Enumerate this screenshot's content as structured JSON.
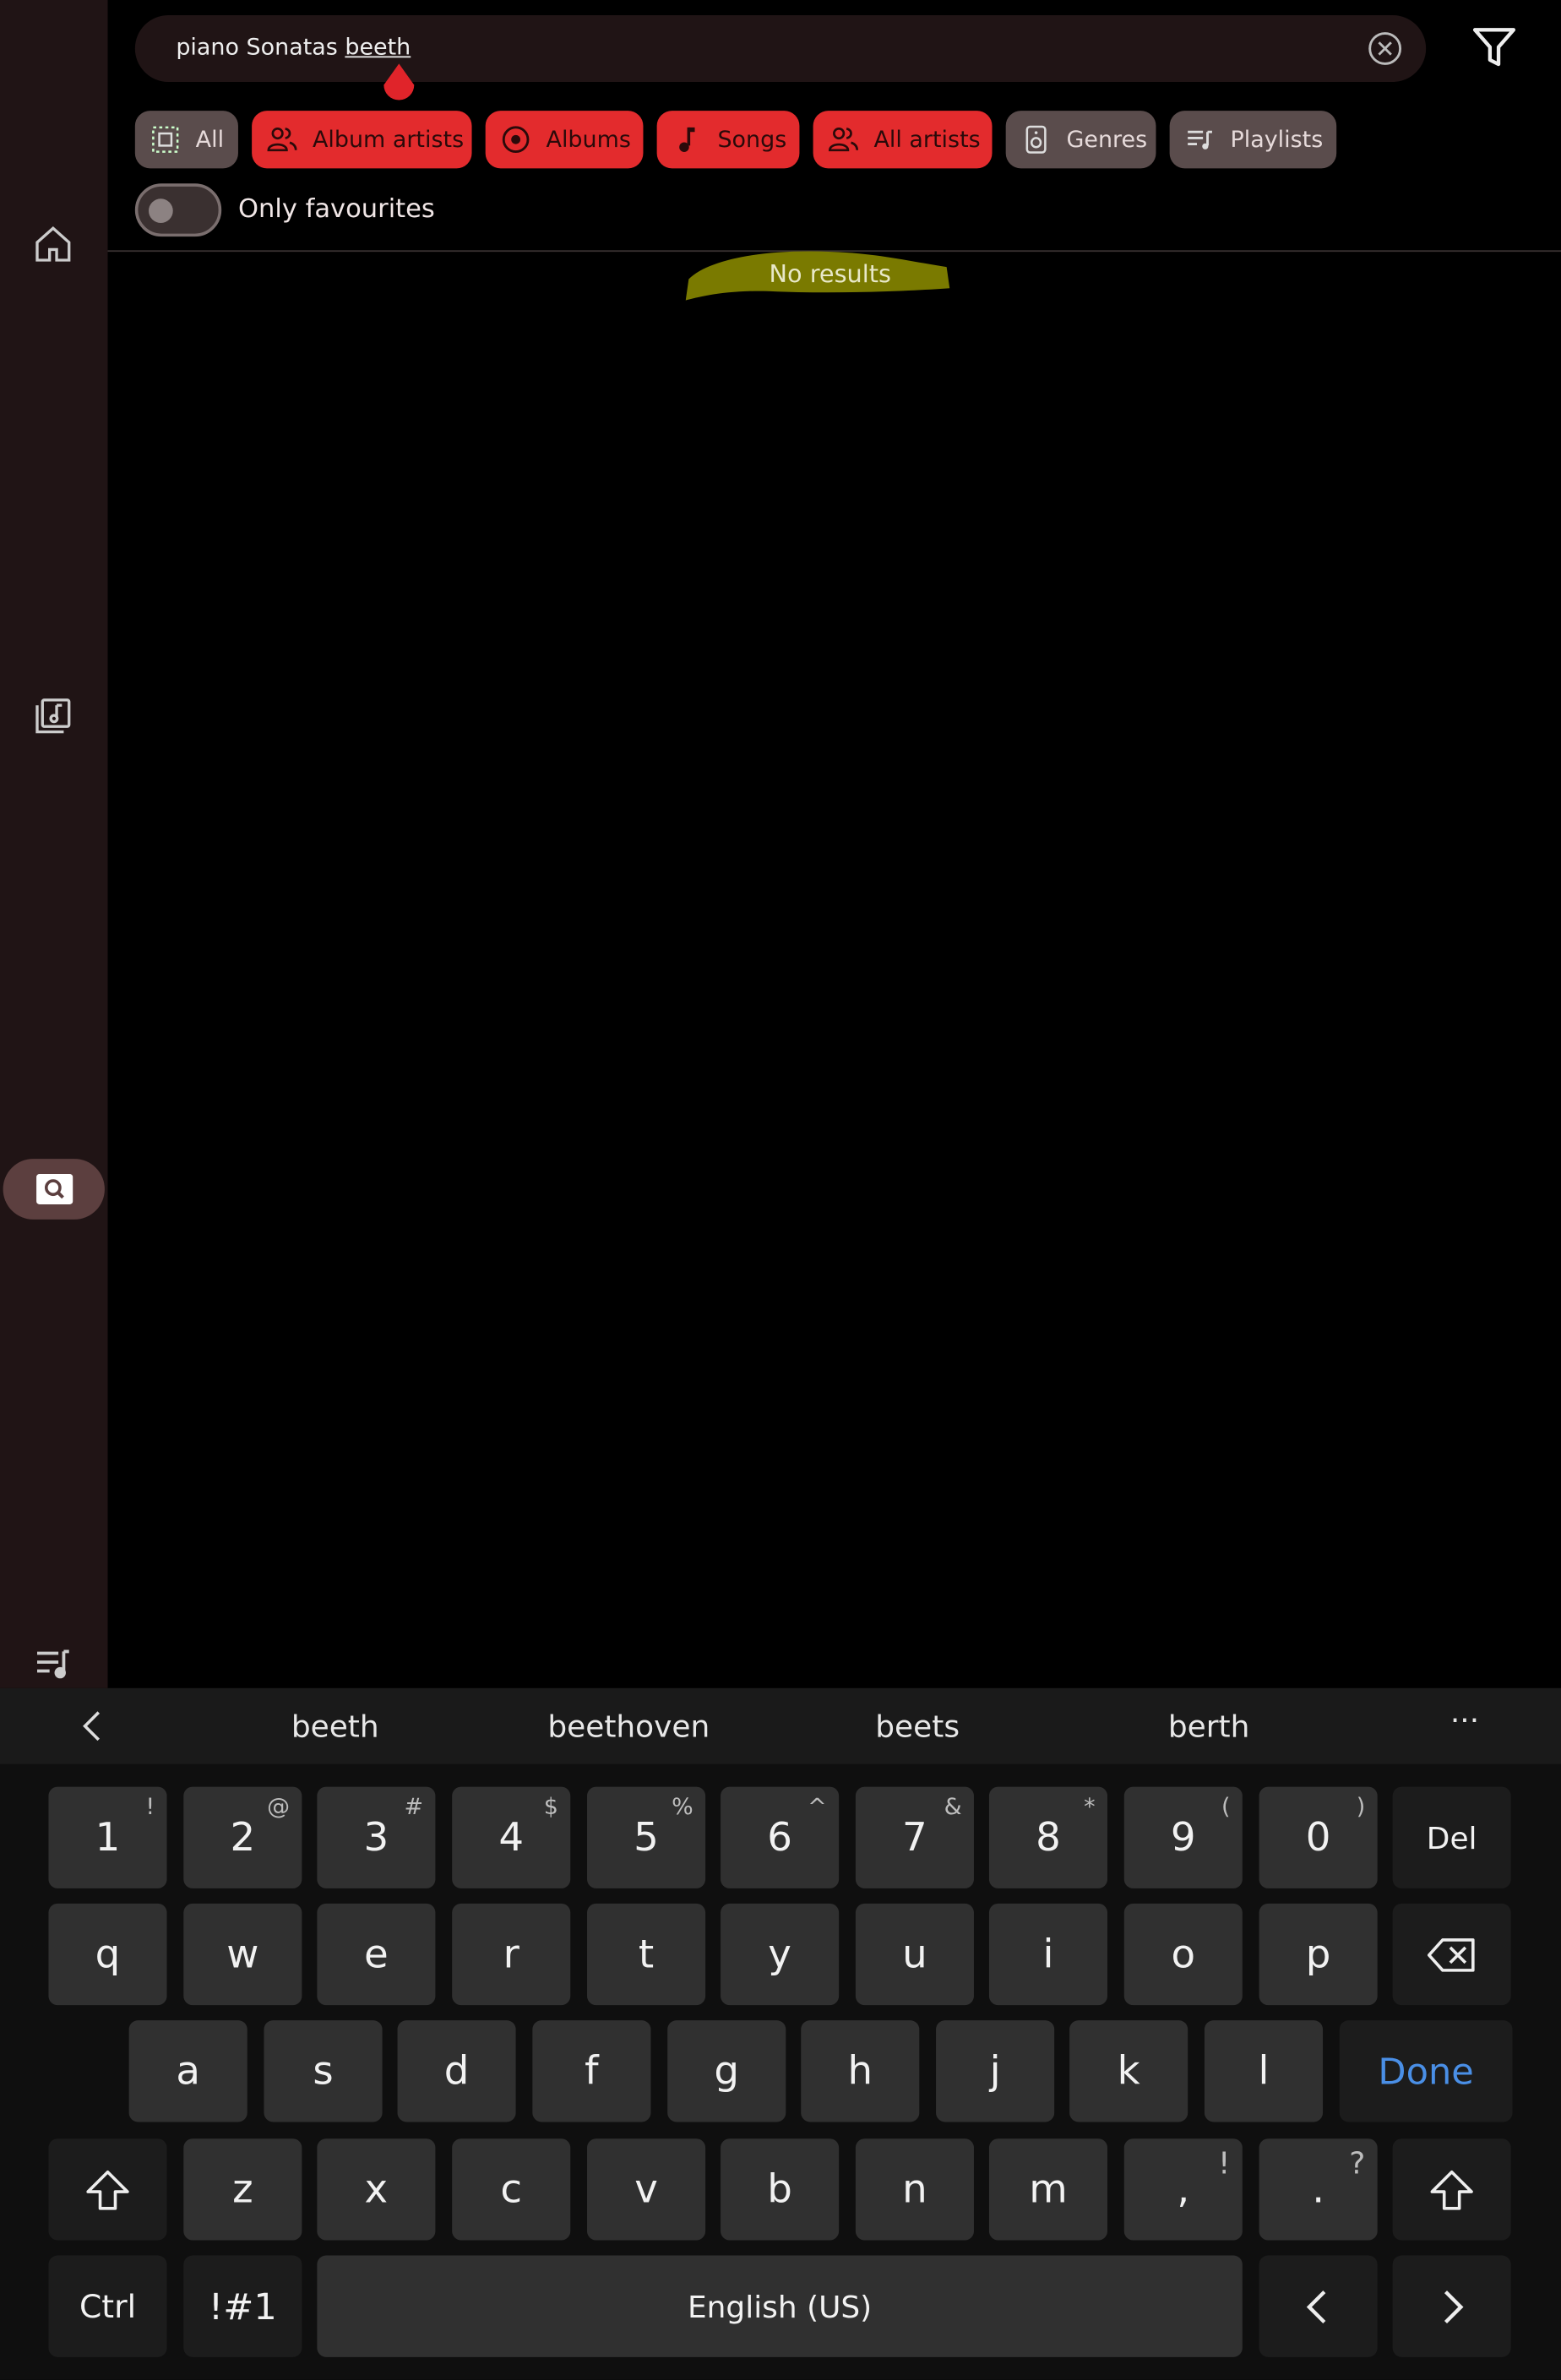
{
  "search": {
    "text_plain": "piano Sonatas ",
    "text_underlined": "beeth"
  },
  "chips": [
    {
      "label": "All",
      "state": "off",
      "icon": "select-all-icon"
    },
    {
      "label": "Album artists",
      "state": "on",
      "icon": "people-icon"
    },
    {
      "label": "Albums",
      "state": "on",
      "icon": "album-disc-icon"
    },
    {
      "label": "Songs",
      "state": "on",
      "icon": "music-note-icon"
    },
    {
      "label": "All artists",
      "state": "on",
      "icon": "people-icon"
    },
    {
      "label": "Genres",
      "state": "off",
      "icon": "speaker-icon"
    },
    {
      "label": "Playlists",
      "state": "off",
      "icon": "playlist-icon"
    }
  ],
  "favourites_toggle": {
    "label": "Only favourites",
    "checked": false
  },
  "results": {
    "empty_message": "No results"
  },
  "sidebar": {
    "icons": [
      "home-icon",
      "library-music-icon",
      "search-icon",
      "queue-music-icon"
    ]
  },
  "keyboard": {
    "suggestions": [
      "beeth",
      "beethoven",
      "beets",
      "berth"
    ],
    "more": "···",
    "row1": [
      {
        "k": "1",
        "s": "!"
      },
      {
        "k": "2",
        "s": "@"
      },
      {
        "k": "3",
        "s": "#"
      },
      {
        "k": "4",
        "s": "$"
      },
      {
        "k": "5",
        "s": "%"
      },
      {
        "k": "6",
        "s": "^"
      },
      {
        "k": "7",
        "s": "&"
      },
      {
        "k": "8",
        "s": "*"
      },
      {
        "k": "9",
        "s": "("
      },
      {
        "k": "0",
        "s": ")"
      }
    ],
    "del": "Del",
    "row2": [
      "q",
      "w",
      "e",
      "r",
      "t",
      "y",
      "u",
      "i",
      "o",
      "p"
    ],
    "row3": [
      "a",
      "s",
      "d",
      "f",
      "g",
      "h",
      "j",
      "k",
      "l"
    ],
    "done": "Done",
    "row4": [
      {
        "k": "z",
        "s": ""
      },
      {
        "k": "x",
        "s": ""
      },
      {
        "k": "c",
        "s": ""
      },
      {
        "k": "v",
        "s": ""
      },
      {
        "k": "b",
        "s": ""
      },
      {
        "k": "n",
        "s": ""
      },
      {
        "k": "m",
        "s": ""
      },
      {
        "k": ",",
        "s": "!"
      },
      {
        "k": ".",
        "s": "?"
      }
    ],
    "ctrl": "Ctrl",
    "symbols": "!#1",
    "space": "English (US)"
  },
  "colors": {
    "accent": "#e32b2d",
    "highlight": "#7a7a00",
    "done": "#4a8fe6"
  }
}
